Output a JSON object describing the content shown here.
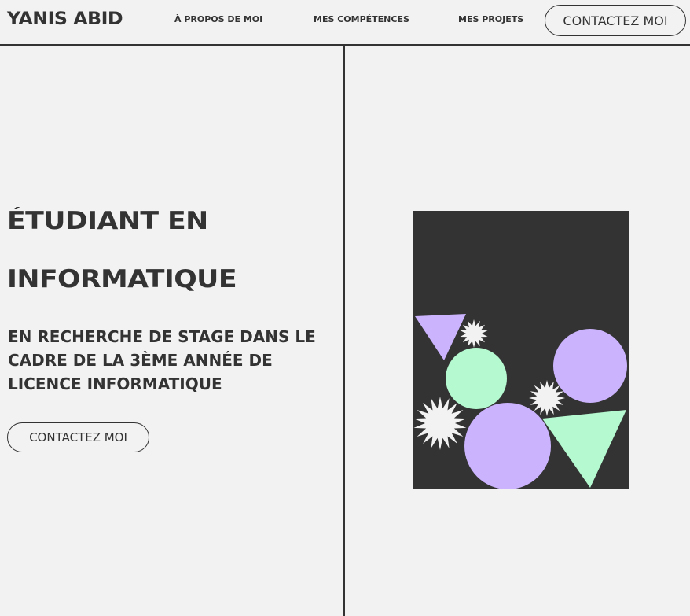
{
  "header": {
    "brand": "YANIS ABID",
    "nav": [
      {
        "label": "À PROPOS DE MOI"
      },
      {
        "label": "MES COMPÉTENCES"
      },
      {
        "label": "MES PROJETS"
      }
    ],
    "cta_label": "CONTACTEZ MOI"
  },
  "hero": {
    "title_line1": "ÉTUDIANT EN",
    "title_line2": "INFORMATIQUE",
    "subtitle": "EN RECHERCHE DE STAGE DANS LE CADRE DE LA 3ÈME ANNÉE DE LICENCE INFORMATIQUE",
    "cta_label": "CONTACTEZ MOI"
  },
  "artwork": {
    "shapes": [
      {
        "name": "purple-triangle-icon"
      },
      {
        "name": "white-starburst-small-icon"
      },
      {
        "name": "mint-circle-icon"
      },
      {
        "name": "purple-circle-right-icon"
      },
      {
        "name": "white-starburst-medium-icon"
      },
      {
        "name": "white-starburst-large-icon"
      },
      {
        "name": "purple-circle-bottom-icon"
      },
      {
        "name": "mint-triangle-icon"
      }
    ]
  },
  "colors": {
    "background": "#f2f2f2",
    "text": "#333333",
    "artwork_bg": "#333333",
    "purple": "#cbb3fd",
    "mint": "#b4f9cf",
    "white": "#f2f2f2"
  }
}
